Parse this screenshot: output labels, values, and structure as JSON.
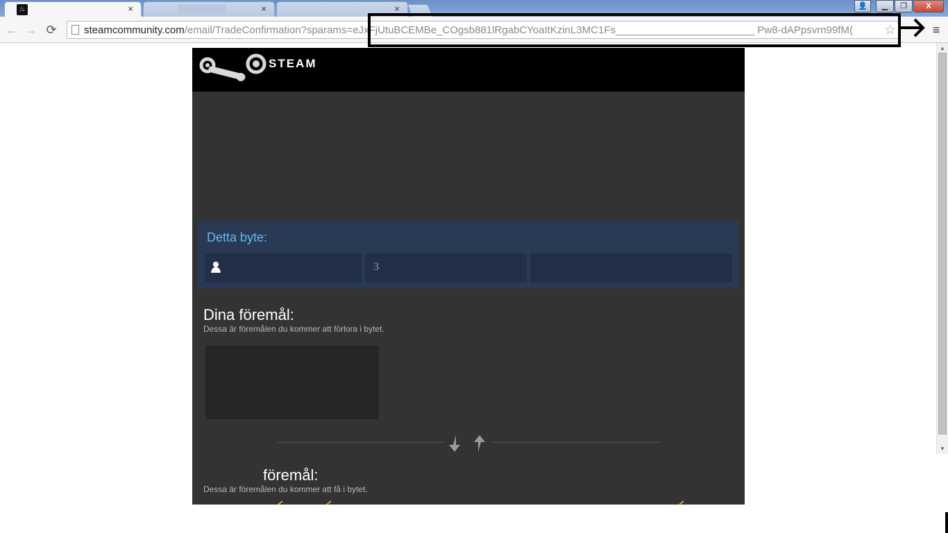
{
  "browser": {
    "tabs": [
      {
        "title": "",
        "favicon": "steam-icon",
        "close": "×"
      },
      {
        "title": "",
        "close": "×"
      },
      {
        "title": "",
        "close": "×"
      }
    ],
    "window_buttons": {
      "minimize": "▁",
      "restore": "❐",
      "close": "X"
    },
    "nav": {
      "back": "←",
      "forward": "→",
      "reload": "⟳"
    },
    "address": {
      "url_host": "steamcommunity.com",
      "url_rest": "/email/TradeConfirmation?sparams=eJxFjUtuBCEMBe_COgsb881lRgabCYoaItKzinL3MC1Fs________________________ Pw8-dAPpsvrn99fM("
    },
    "star": "☆",
    "menu": "≡"
  },
  "steam": {
    "logo_text": "STEAM",
    "trade_title": "Detta byte:",
    "cell_value": "3",
    "your_items_title": "Dina föremål:",
    "your_items_desc": "Dessa är föremålen du kommer att förlora i bytet.",
    "their_items_title": "föremål:",
    "their_items_desc": "Dessa är föremålen du kommer att få i bytet.",
    "accent_color": "#66b8f2"
  }
}
